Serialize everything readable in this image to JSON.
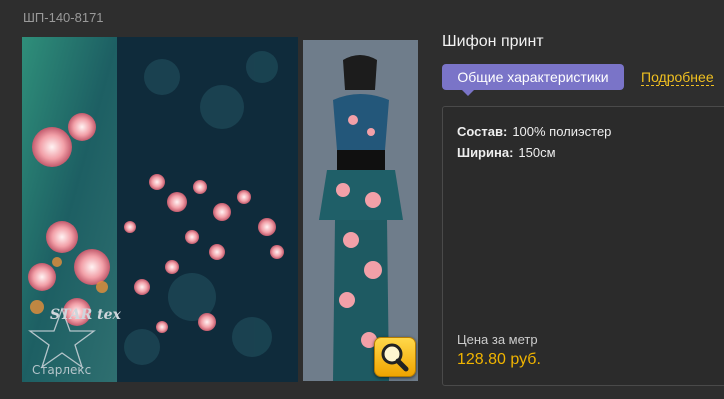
{
  "product": {
    "sku": "ШП-140-8171",
    "title": "Шифон принт"
  },
  "tabs": {
    "active": "Общие характеристики",
    "more": "Подробнее"
  },
  "specs": [
    {
      "label": "Состав:",
      "value": "100% полиэстер"
    },
    {
      "label": "Ширина:",
      "value": "150см"
    }
  ],
  "price": {
    "label": "Цена за метр",
    "value": "128.80 руб."
  },
  "watermark": {
    "logo": "STAR tex",
    "text": "Старлекс"
  },
  "colors": {
    "background": "#2e2e2e",
    "tab_active": "#7a74c8",
    "accent": "#f0b400"
  },
  "icons": {
    "zoom": "magnifier-icon"
  }
}
